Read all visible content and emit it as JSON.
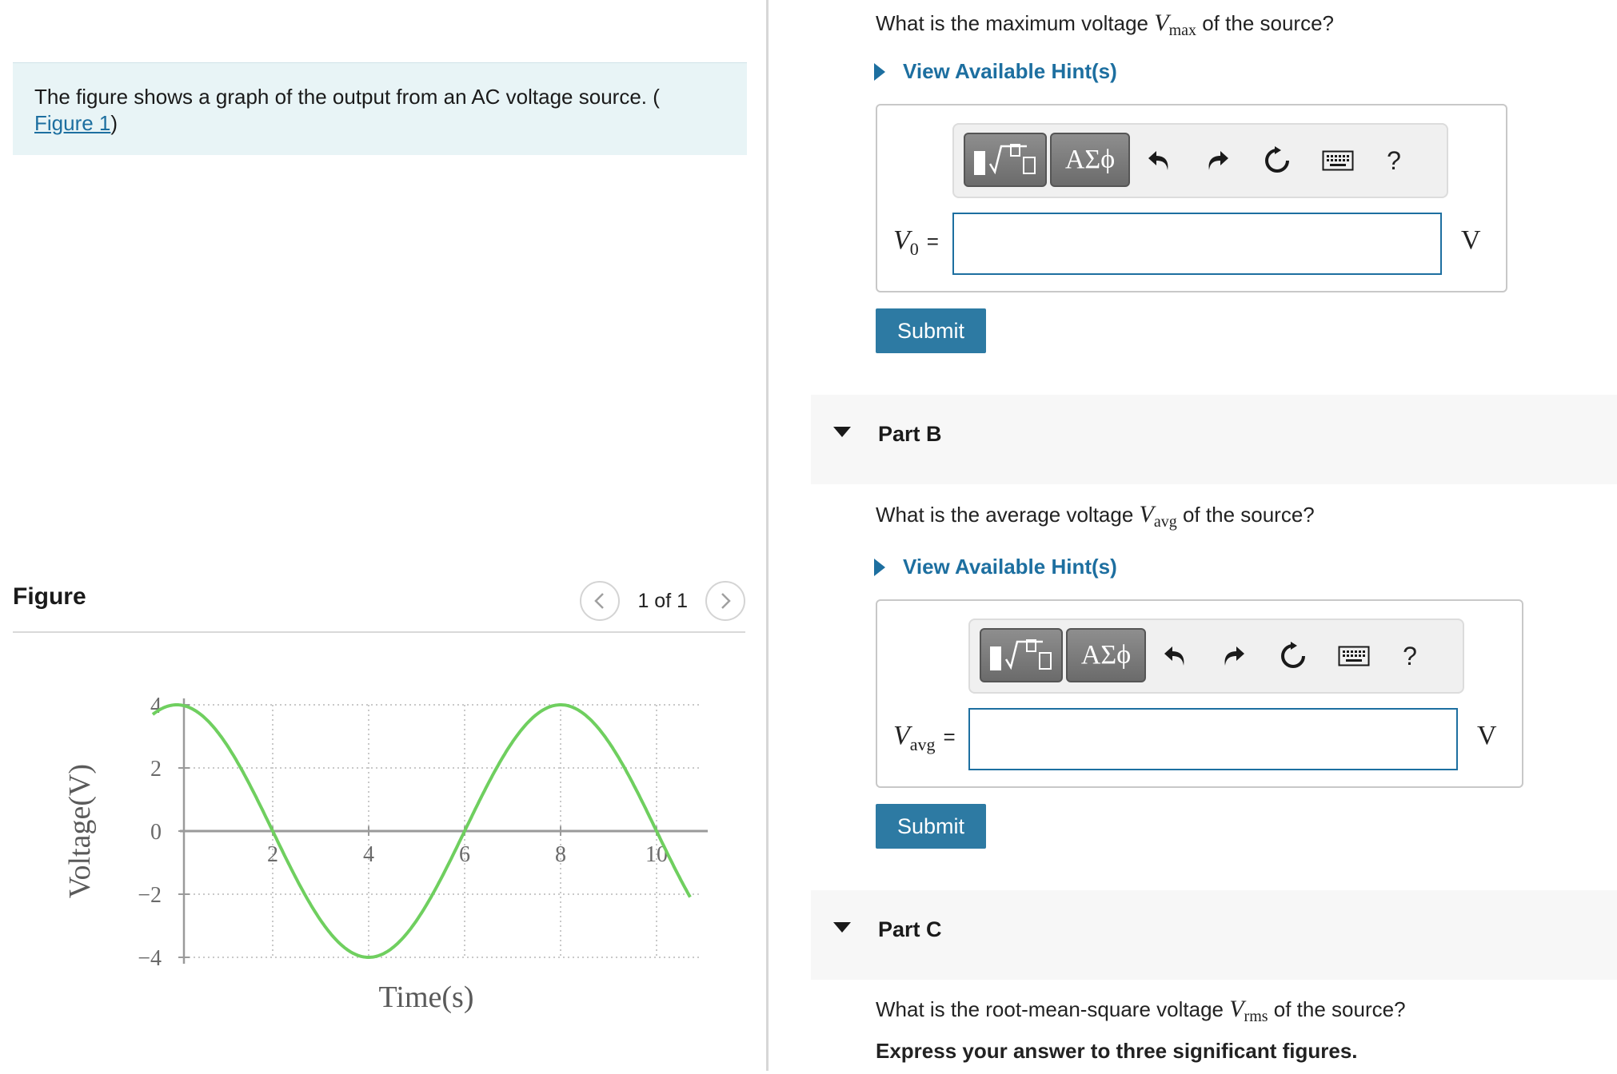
{
  "intro": {
    "text": "The figure shows a graph of the output from an AC voltage source. (",
    "link": "Figure 1",
    "close": ")"
  },
  "figure": {
    "title": "Figure",
    "pager": "1 of 1"
  },
  "partA": {
    "question_pre": "What is the maximum voltage ",
    "var": "V",
    "var_sub": "max",
    "question_post": " of the source?",
    "hint": "View Available Hint(s)",
    "toolbar_symbols": "ΑΣϕ",
    "input_var": "V",
    "input_sub": "0",
    "eq": "=",
    "unit": "V",
    "submit": "Submit"
  },
  "partB": {
    "label": "Part B",
    "question_pre": "What is the average voltage ",
    "var": "V",
    "var_sub": "avg",
    "question_post": " of the source?",
    "hint": "View Available Hint(s)",
    "toolbar_symbols": "ΑΣϕ",
    "input_var": "V",
    "input_sub": "avg",
    "eq": "=",
    "unit": "V",
    "submit": "Submit"
  },
  "partC": {
    "label": "Part C",
    "question_pre": "What is the root-mean-square voltage ",
    "var": "V",
    "var_sub": "rms",
    "question_post": " of the source?",
    "note": "Express your answer to three significant figures."
  },
  "colors": {
    "accent": "#1d6fa0",
    "submit": "#2d7aa3",
    "curve": "#6fcf5f",
    "intro_bg": "#e8f4f6"
  },
  "chart_data": {
    "type": "line",
    "xlabel": "Time(s)",
    "ylabel": "Voltage(V)",
    "xticks": [
      "2",
      "4",
      "6",
      "8",
      "10"
    ],
    "yticks": [
      "4",
      "2",
      "0",
      "−2",
      "−4"
    ],
    "xlim": [
      -0.5,
      11
    ],
    "ylim": [
      -4,
      4
    ],
    "series": [
      {
        "amplitude": 4,
        "period": 8,
        "x_start": -0.5,
        "x_end": 10.7,
        "zero_crossings": [
          2,
          6,
          10
        ],
        "peaks": [
          0.2,
          4.2
        ]
      }
    ],
    "grid": true
  }
}
